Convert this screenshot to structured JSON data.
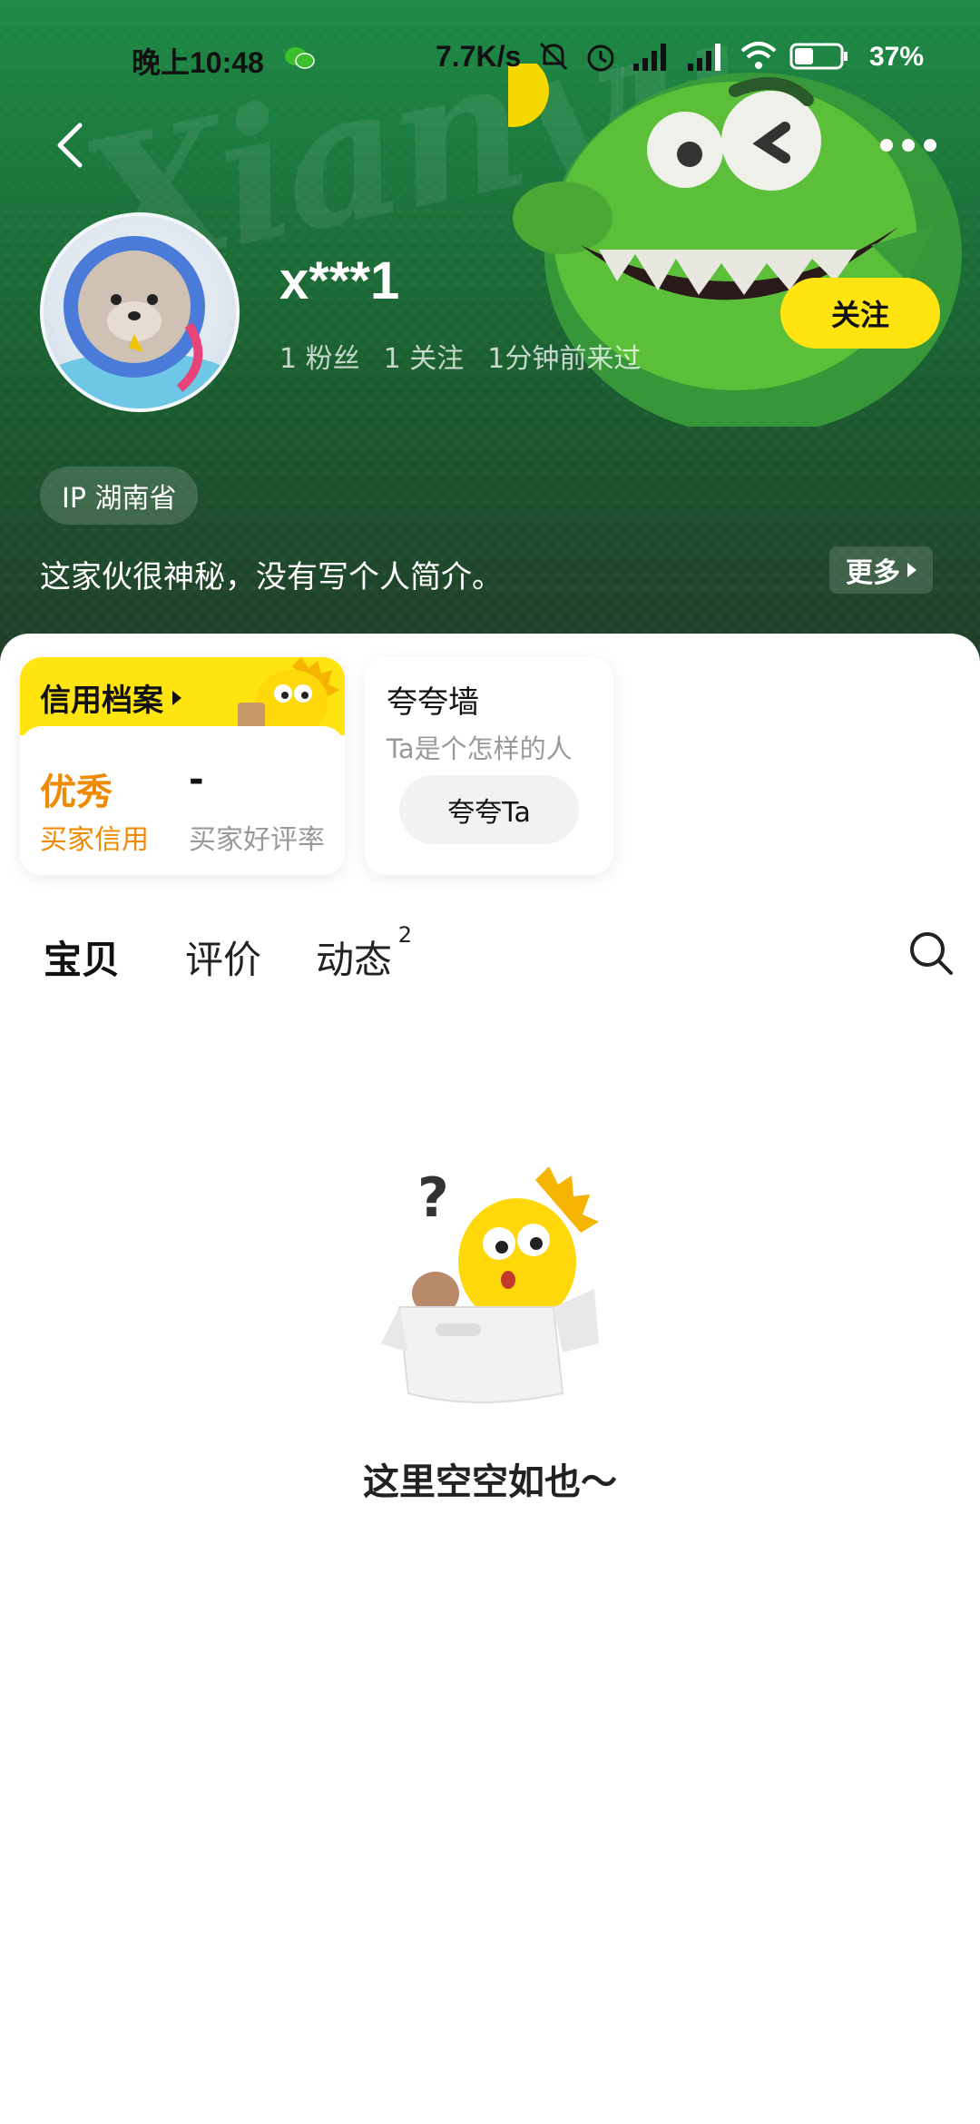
{
  "status_bar": {
    "time": "晚上10:48",
    "net_speed": "7.7K/s",
    "battery": "37%"
  },
  "header": {
    "username": "x***1",
    "stats": {
      "fans": "1 粉丝",
      "following": "1 关注",
      "last_seen": "1分钟前来过"
    },
    "follow_label": "关注",
    "ip_location": "IP 湖南省",
    "bio": "这家伙很神秘，没有写个人简介。",
    "more_label": "更多"
  },
  "credit_card": {
    "title": "信用档案",
    "credit_value": "优秀",
    "credit_label": "买家信用",
    "rate_value": "-",
    "rate_label": "买家好评率"
  },
  "praise_card": {
    "title": "夸夸墙",
    "subtitle": "Ta是个怎样的人",
    "button": "夸夸Ta"
  },
  "tabs": [
    {
      "label": "宝贝",
      "active": true
    },
    {
      "label": "评价",
      "active": false
    },
    {
      "label": "动态",
      "badge": "2",
      "active": false
    }
  ],
  "empty_state": {
    "text": "这里空空如也～"
  },
  "colors": {
    "accent": "#ffe40f",
    "credit": "#f08a00",
    "header_green": "#1d7a3e"
  }
}
